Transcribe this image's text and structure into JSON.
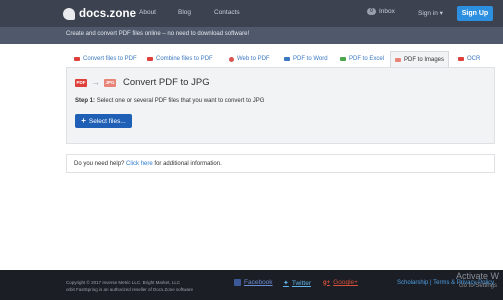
{
  "header": {
    "logo_text": "docs.zone",
    "nav": [
      "About",
      "Blog",
      "Contacts"
    ],
    "inbox_label": "Inbox",
    "inbox_count": "0",
    "signin_label": "Sign in ▾",
    "signup_label": "Sign Up"
  },
  "subbar": {
    "text": "Create and convert PDF files online – no need to download software!"
  },
  "tabs": [
    {
      "label": "Convert files to PDF",
      "icon": "pdf-icon",
      "color": "#e0403a"
    },
    {
      "label": "Combine files to PDF",
      "icon": "combine-icon",
      "color": "#e0403a"
    },
    {
      "label": "Web to PDF",
      "icon": "globe-icon",
      "color": "#d9534f"
    },
    {
      "label": "PDF to Word",
      "icon": "word-icon",
      "color": "#3a78c2"
    },
    {
      "label": "PDF to Excel",
      "icon": "excel-icon",
      "color": "#4aa84a"
    },
    {
      "label": "PDF to Images",
      "icon": "image-icon",
      "color": "#e88378"
    },
    {
      "label": "OCR",
      "icon": "ocr-icon",
      "color": "#e0403a"
    }
  ],
  "active_tab": "PDF to Images",
  "converter": {
    "from_badge": "PDF",
    "to_badge": "JPG",
    "title": "Convert PDF to JPG",
    "step_label": "Step 1:",
    "step_text": "Select one or several PDF files that you want to convert to JPG",
    "select_button": "Select files..."
  },
  "help": {
    "prefix": "Do you need help?",
    "link": "Click here",
    "suffix": "for additional information."
  },
  "footer": {
    "copyright_line1": "Copyright © 2017 Inverse Metric LLC. Bright Market, LLC",
    "copyright_line2": "orbit FastSpring is an authorized reseller of Docs.Zone software",
    "facebook": "Facebook",
    "twitter": "Twitter",
    "googleplus": "Google+",
    "links": "Scholarship | Terms & Privacy Policy"
  },
  "watermark": {
    "line1": "Activate W",
    "line2": "Go to Settings"
  },
  "colors": {
    "topbar": "#3c4250",
    "subbar": "#4f596b",
    "signup": "#2d8fe0",
    "select_button": "#1f5fb5",
    "footer": "#1b1e24"
  }
}
